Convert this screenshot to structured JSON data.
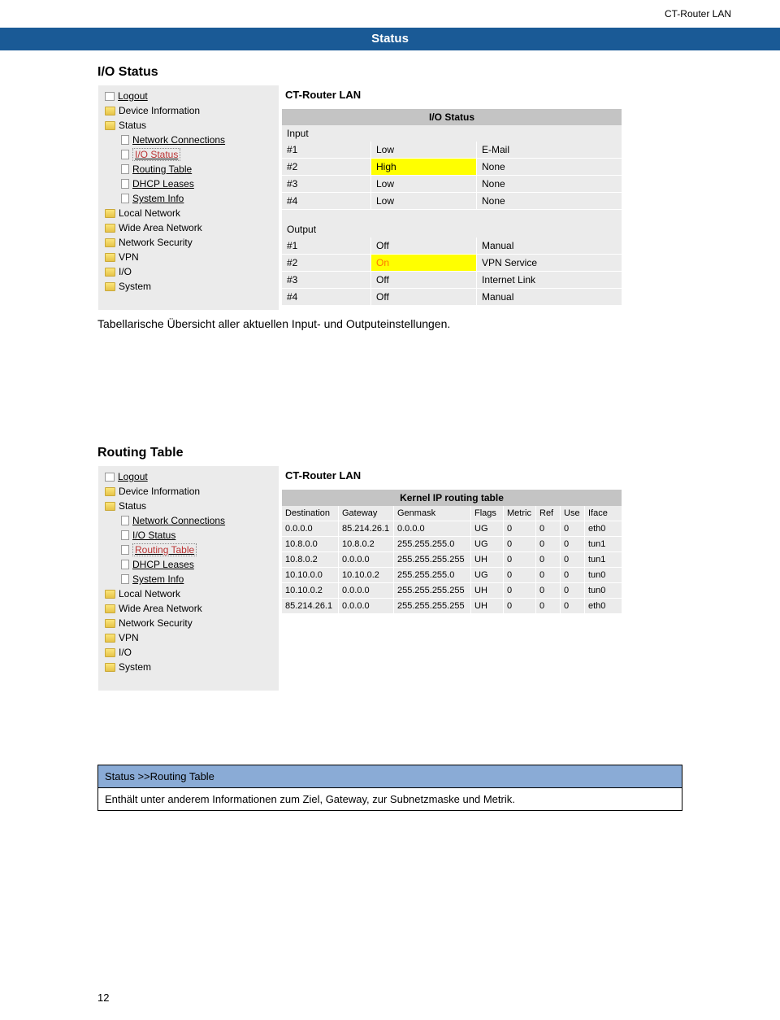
{
  "page_header": "CT-Router LAN",
  "banner": "Status",
  "page_number": "12",
  "section1": {
    "heading": "I/O Status",
    "content_title": "CT-Router LAN",
    "panel_title": "I/O Status",
    "input_label": "Input",
    "output_label": "Output",
    "inputs": [
      {
        "n": "#1",
        "v": "Low",
        "m": "E-Mail",
        "hl": false
      },
      {
        "n": "#2",
        "v": "High",
        "m": "None",
        "hl": true
      },
      {
        "n": "#3",
        "v": "Low",
        "m": "None",
        "hl": false
      },
      {
        "n": "#4",
        "v": "Low",
        "m": "None",
        "hl": false
      }
    ],
    "outputs": [
      {
        "n": "#1",
        "v": "Off",
        "m": "Manual",
        "hl": false
      },
      {
        "n": "#2",
        "v": "On",
        "m": "VPN Service",
        "hl": true
      },
      {
        "n": "#3",
        "v": "Off",
        "m": "Internet Link",
        "hl": false
      },
      {
        "n": "#4",
        "v": "Off",
        "m": "Manual",
        "hl": false
      }
    ],
    "caption": "Tabellarische Übersicht aller aktuellen Input- und Outputeinstellungen."
  },
  "nav1": {
    "items": [
      {
        "type": "door",
        "label": "Logout",
        "link": true
      },
      {
        "type": "folder",
        "label": "Device Information"
      },
      {
        "type": "folder",
        "label": "Status"
      },
      {
        "type": "doc",
        "label": "Network Connections",
        "link": true,
        "sub": true
      },
      {
        "type": "doc",
        "label": "I/O Status",
        "link": true,
        "sub": true,
        "boxed": true
      },
      {
        "type": "doc",
        "label": "Routing Table",
        "link": true,
        "sub": true
      },
      {
        "type": "doc",
        "label": "DHCP Leases",
        "link": true,
        "sub": true
      },
      {
        "type": "doc",
        "label": "System Info",
        "link": true,
        "sub": true
      },
      {
        "type": "folder",
        "label": "Local Network"
      },
      {
        "type": "folder",
        "label": "Wide Area Network"
      },
      {
        "type": "folder",
        "label": "Network Security"
      },
      {
        "type": "folder",
        "label": "VPN"
      },
      {
        "type": "folder",
        "label": "I/O"
      },
      {
        "type": "folder",
        "label": "System"
      }
    ]
  },
  "section2": {
    "heading": "Routing Table",
    "content_title": "CT-Router LAN",
    "panel_title": "Kernel IP routing table",
    "columns": [
      "Destination",
      "Gateway",
      "Genmask",
      "Flags",
      "Metric",
      "Ref",
      "Use",
      "Iface"
    ],
    "rows": [
      [
        "0.0.0.0",
        "85.214.26.1",
        "0.0.0.0",
        "UG",
        "0",
        "0",
        "0",
        "eth0"
      ],
      [
        "10.8.0.0",
        "10.8.0.2",
        "255.255.255.0",
        "UG",
        "0",
        "0",
        "0",
        "tun1"
      ],
      [
        "10.8.0.2",
        "0.0.0.0",
        "255.255.255.255",
        "UH",
        "0",
        "0",
        "0",
        "tun1"
      ],
      [
        "10.10.0.0",
        "10.10.0.2",
        "255.255.255.0",
        "UG",
        "0",
        "0",
        "0",
        "tun0"
      ],
      [
        "10.10.0.2",
        "0.0.0.0",
        "255.255.255.255",
        "UH",
        "0",
        "0",
        "0",
        "tun0"
      ],
      [
        "85.214.26.1",
        "0.0.0.0",
        "255.255.255.255",
        "UH",
        "0",
        "0",
        "0",
        "eth0"
      ]
    ]
  },
  "nav2": {
    "items": [
      {
        "type": "door",
        "label": "Logout",
        "link": true
      },
      {
        "type": "folder",
        "label": "Device Information"
      },
      {
        "type": "folder",
        "label": "Status"
      },
      {
        "type": "doc",
        "label": "Network Connections",
        "link": true,
        "sub": true
      },
      {
        "type": "doc",
        "label": "I/O Status",
        "link": true,
        "sub": true
      },
      {
        "type": "doc",
        "label": "Routing Table",
        "link": true,
        "sub": true,
        "boxed": true
      },
      {
        "type": "doc",
        "label": "DHCP Leases",
        "link": true,
        "sub": true
      },
      {
        "type": "doc",
        "label": "System Info",
        "link": true,
        "sub": true
      },
      {
        "type": "folder",
        "label": "Local Network"
      },
      {
        "type": "folder",
        "label": "Wide Area Network"
      },
      {
        "type": "folder",
        "label": "Network Security"
      },
      {
        "type": "folder",
        "label": "VPN"
      },
      {
        "type": "folder",
        "label": "I/O"
      },
      {
        "type": "folder",
        "label": "System"
      }
    ]
  },
  "info": {
    "header": "Status >>Routing Table",
    "body": "Enthält unter anderem Informationen zum Ziel, Gateway, zur Subnetzmaske und Metrik."
  }
}
